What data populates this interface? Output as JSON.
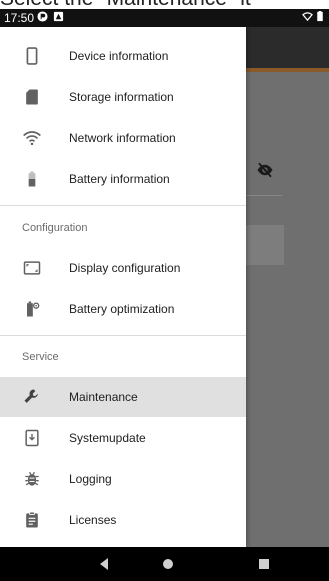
{
  "instruction": "Select the \"Maintenance\" it",
  "status_bar": {
    "time": "17:50"
  },
  "drawer": {
    "items_top": [
      {
        "label": "Device information",
        "icon": "phone-icon"
      },
      {
        "label": "Storage information",
        "icon": "sd-card-icon"
      },
      {
        "label": "Network information",
        "icon": "wifi-icon"
      },
      {
        "label": "Battery information",
        "icon": "battery-icon"
      }
    ],
    "sections": [
      {
        "title": "Configuration",
        "items": [
          {
            "label": "Display configuration",
            "icon": "display-icon"
          },
          {
            "label": "Battery optimization",
            "icon": "battery-settings-icon"
          }
        ]
      },
      {
        "title": "Service",
        "items": [
          {
            "label": "Maintenance",
            "icon": "wrench-icon",
            "selected": true
          },
          {
            "label": "Systemupdate",
            "icon": "system-update-icon"
          },
          {
            "label": "Logging",
            "icon": "bug-icon"
          },
          {
            "label": "Licenses",
            "icon": "clipboard-icon"
          }
        ]
      }
    ]
  },
  "colors": {
    "selected_bg": "#e0e0e0",
    "scrim": "#6f6f6f",
    "icon": "#616161"
  }
}
